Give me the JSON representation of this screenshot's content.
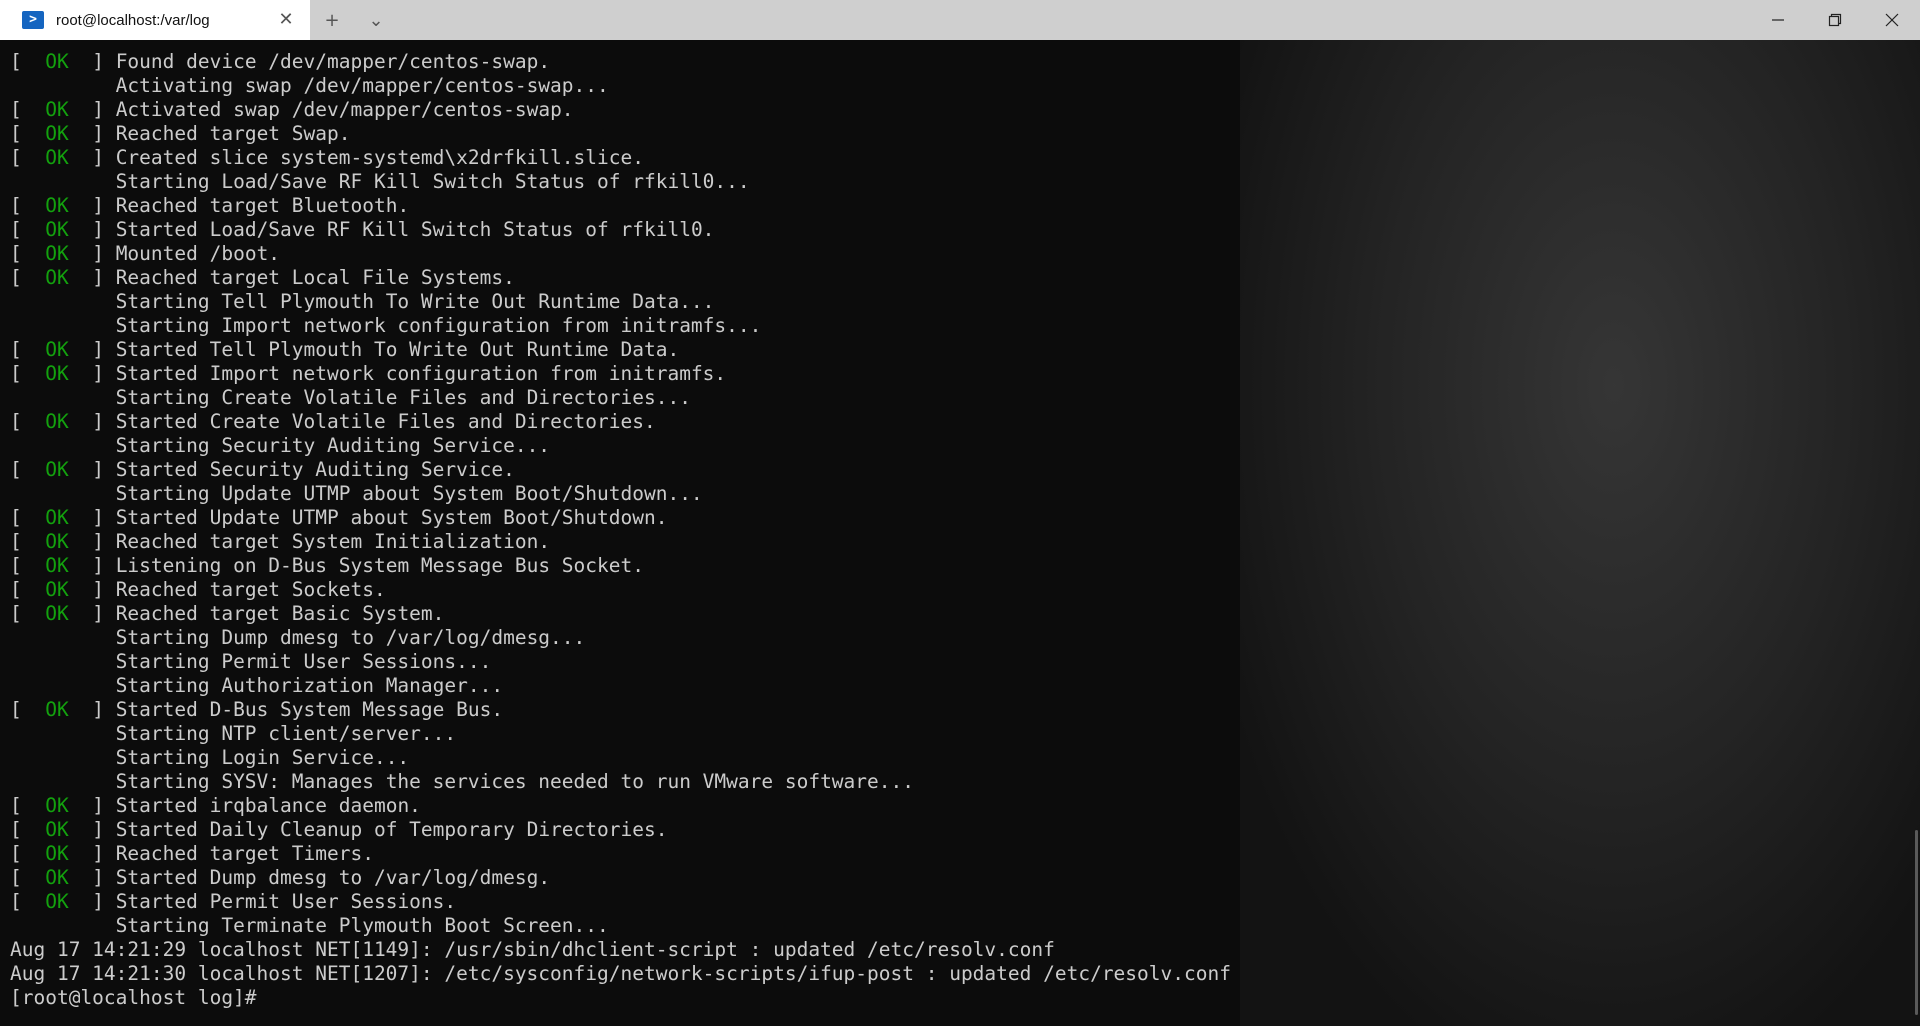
{
  "titlebar": {
    "tab_title": "root@localhost:/var/log",
    "tab_icon": "powershell-icon",
    "new_tab_icon": "+",
    "dropdown_icon": "⌄",
    "close_tab_icon": "✕",
    "minimize_icon": "—",
    "maximize_icon": "❐",
    "close_icon": "✕"
  },
  "colors": {
    "ok": "#13a10e",
    "text": "#cccccc",
    "background": "#0c0c0c",
    "titlebar": "#cfcfcf"
  },
  "terminal": {
    "lines": [
      {
        "ok": true,
        "text": "Found device /dev/mapper/centos-swap."
      },
      {
        "ok": false,
        "text": "Activating swap /dev/mapper/centos-swap..."
      },
      {
        "ok": true,
        "text": "Activated swap /dev/mapper/centos-swap."
      },
      {
        "ok": true,
        "text": "Reached target Swap."
      },
      {
        "ok": true,
        "text": "Created slice system-systemd\\x2drfkill.slice."
      },
      {
        "ok": false,
        "text": "Starting Load/Save RF Kill Switch Status of rfkill0..."
      },
      {
        "ok": true,
        "text": "Reached target Bluetooth."
      },
      {
        "ok": true,
        "text": "Started Load/Save RF Kill Switch Status of rfkill0."
      },
      {
        "ok": true,
        "text": "Mounted /boot."
      },
      {
        "ok": true,
        "text": "Reached target Local File Systems."
      },
      {
        "ok": false,
        "text": "Starting Tell Plymouth To Write Out Runtime Data..."
      },
      {
        "ok": false,
        "text": "Starting Import network configuration from initramfs..."
      },
      {
        "ok": true,
        "text": "Started Tell Plymouth To Write Out Runtime Data."
      },
      {
        "ok": true,
        "text": "Started Import network configuration from initramfs."
      },
      {
        "ok": false,
        "text": "Starting Create Volatile Files and Directories..."
      },
      {
        "ok": true,
        "text": "Started Create Volatile Files and Directories."
      },
      {
        "ok": false,
        "text": "Starting Security Auditing Service..."
      },
      {
        "ok": true,
        "text": "Started Security Auditing Service."
      },
      {
        "ok": false,
        "text": "Starting Update UTMP about System Boot/Shutdown..."
      },
      {
        "ok": true,
        "text": "Started Update UTMP about System Boot/Shutdown."
      },
      {
        "ok": true,
        "text": "Reached target System Initialization."
      },
      {
        "ok": true,
        "text": "Listening on D-Bus System Message Bus Socket."
      },
      {
        "ok": true,
        "text": "Reached target Sockets."
      },
      {
        "ok": true,
        "text": "Reached target Basic System."
      },
      {
        "ok": false,
        "text": "Starting Dump dmesg to /var/log/dmesg..."
      },
      {
        "ok": false,
        "text": "Starting Permit User Sessions..."
      },
      {
        "ok": false,
        "text": "Starting Authorization Manager..."
      },
      {
        "ok": true,
        "text": "Started D-Bus System Message Bus."
      },
      {
        "ok": false,
        "text": "Starting NTP client/server..."
      },
      {
        "ok": false,
        "text": "Starting Login Service..."
      },
      {
        "ok": false,
        "text": "Starting SYSV: Manages the services needed to run VMware software..."
      },
      {
        "ok": true,
        "text": "Started irqbalance daemon."
      },
      {
        "ok": true,
        "text": "Started Daily Cleanup of Temporary Directories."
      },
      {
        "ok": true,
        "text": "Reached target Timers."
      },
      {
        "ok": true,
        "text": "Started Dump dmesg to /var/log/dmesg."
      },
      {
        "ok": true,
        "text": "Started Permit User Sessions."
      },
      {
        "ok": false,
        "text": "Starting Terminate Plymouth Boot Screen..."
      },
      {
        "raw": "Aug 17 14:21:29 localhost NET[1149]: /usr/sbin/dhclient-script : updated /etc/resolv.conf"
      },
      {
        "raw": "Aug 17 14:21:30 localhost NET[1207]: /etc/sysconfig/network-scripts/ifup-post : updated /etc/resolv.conf"
      },
      {
        "raw": "[root@localhost log]# "
      }
    ],
    "ok_label": "OK"
  }
}
